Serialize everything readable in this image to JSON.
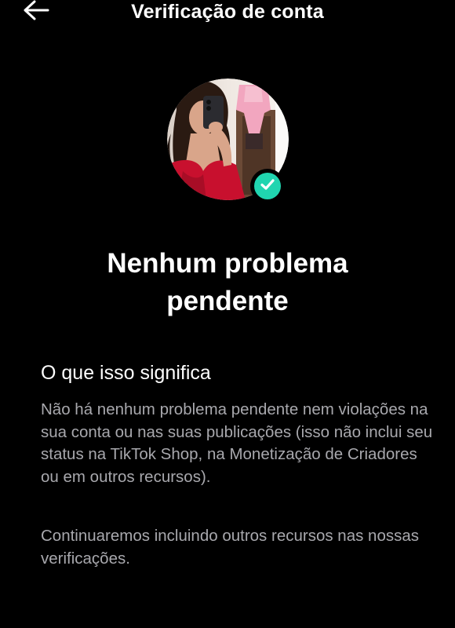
{
  "header": {
    "title": "Verificação de conta",
    "back_icon": "arrow-left-icon"
  },
  "profile": {
    "verified_badge_icon": "check-icon",
    "badge_color": "#20d5b0"
  },
  "status": {
    "title": "Nenhum problema pendente"
  },
  "info": {
    "heading": "O que isso significa",
    "paragraph_1": "Não há nenhum problema pendente nem violações na sua conta ou nas suas publicações (isso não inclui seu status na TikTok Shop, na Monetização de Criadores ou em outros recursos).",
    "paragraph_2": "Continuaremos incluindo outros recursos nas nossas verificações."
  },
  "colors": {
    "background": "#000000",
    "text_primary": "#ffffff",
    "text_secondary": "#a8a8ad"
  }
}
